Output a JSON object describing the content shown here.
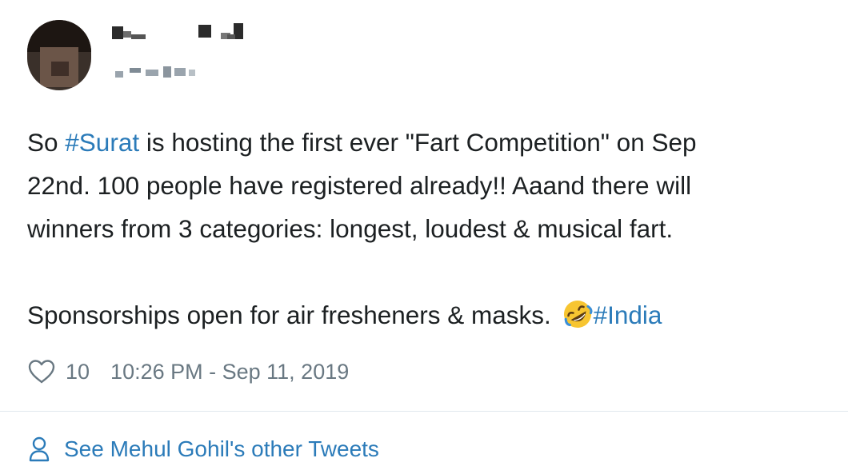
{
  "tweet": {
    "line1": {
      "prefix": "So ",
      "hashtag": "#Surat",
      "suffix": " is hosting the first ever \"Fart Competition\" on Sep"
    },
    "line2": "22nd. 100 people have registered already!! Aaand there will",
    "line3": "winners from 3 categories: longest, loudest & musical fart.",
    "line4": {
      "text": "Sponsorships open for air fresheners & masks. ",
      "emoji_icon": "rolling-on-floor-laughing-emoji",
      "hashtag": "#India"
    }
  },
  "meta": {
    "like_icon": "heart-icon",
    "likes": "10",
    "timestamp": "10:26 PM - Sep 11, 2019"
  },
  "footer": {
    "icon": "person-icon",
    "link_text": "See Mehul Gohil's other Tweets"
  },
  "colors": {
    "text": "#1c2022",
    "link": "#2b7bb9",
    "muted": "#697882",
    "divider": "#e1e8ed"
  }
}
